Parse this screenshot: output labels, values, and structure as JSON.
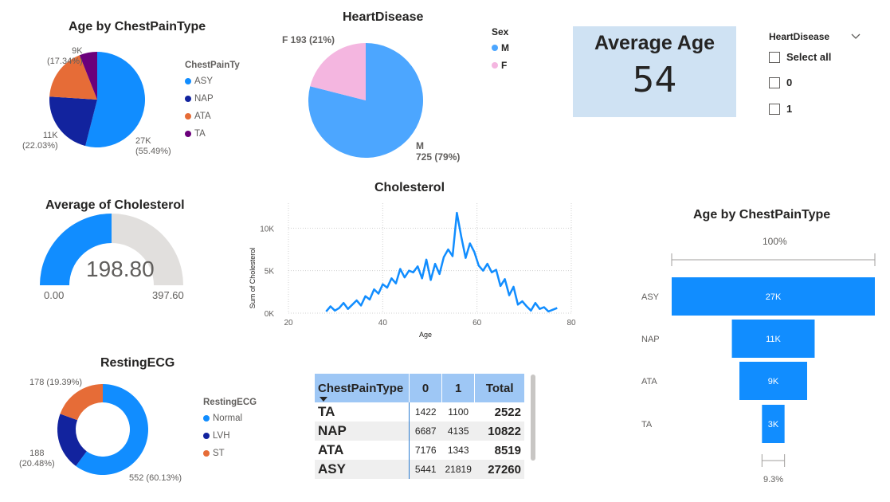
{
  "colors": {
    "asy": "#118dff",
    "nap": "#12239e",
    "ata": "#e66c37",
    "ta": "#6b007b",
    "male": "#4ca6ff",
    "female": "#f4b6e0",
    "gauge_fill": "#118dff",
    "gauge_bg": "#e1dfdd",
    "header": "#9ec7f5",
    "card_bg": "#cfe2f3"
  },
  "pie_age": {
    "title": "Age by ChestPainType",
    "legend_title": "ChestPainTy",
    "labels": {
      "asy": "27K\n(55.49%)",
      "nap": "11K\n(22.03%)",
      "ata": "9K\n(17.34%)"
    },
    "label_asy_1": "27K",
    "label_asy_2": "(55.49%)",
    "label_nap_1": "11K",
    "label_nap_2": "(22.03%)",
    "label_ata_1": "9K",
    "label_ata_2": "(17.34%)"
  },
  "pie_hd": {
    "title": "HeartDisease",
    "legend_title": "Sex",
    "label_f": "F 193 (21%)",
    "label_m_1": "M",
    "label_m_2": "725 (79%)",
    "legend": [
      "M",
      "F"
    ]
  },
  "card": {
    "title": "Average Age",
    "value": "54"
  },
  "slicer": {
    "title": "HeartDisease",
    "items": [
      "Select all",
      "0",
      "1"
    ]
  },
  "gauge": {
    "title": "Average of Cholesterol",
    "value": "198.80",
    "min": "0.00",
    "max": "397.60"
  },
  "line": {
    "title": "Cholesterol",
    "xlabel": "Age",
    "ylabel": "Sum of Cholesterol",
    "xticks": [
      "20",
      "40",
      "60",
      "80"
    ],
    "yticks": [
      "0K",
      "5K",
      "10K"
    ]
  },
  "donut": {
    "title": "RestingECG",
    "legend_title": "RestingECG",
    "label_st_1": "178 (19.39%)",
    "label_lvh_1": "188",
    "label_lvh_2": "(20.48%)",
    "label_normal": "552 (60.13%)"
  },
  "matrix": {
    "headers": [
      "ChestPainType",
      "0",
      "1",
      "Total"
    ],
    "rows": [
      {
        "type": "TA",
        "c0": "1422",
        "c1": "1100",
        "total": "2522"
      },
      {
        "type": "NAP",
        "c0": "6687",
        "c1": "4135",
        "total": "10822"
      },
      {
        "type": "ATA",
        "c0": "7176",
        "c1": "1343",
        "total": "8519"
      },
      {
        "type": "ASY",
        "c0": "5441",
        "c1": "21819",
        "total": "27260"
      }
    ]
  },
  "funnel": {
    "title": "Age by ChestPainType",
    "top_pct": "100%",
    "bottom_pct": "9.3%"
  },
  "chart_data": [
    {
      "type": "pie",
      "title": "Age by ChestPainType",
      "legend_title": "ChestPainTy",
      "categories": [
        "ASY",
        "NAP",
        "ATA",
        "TA"
      ],
      "values": [
        27000,
        11000,
        9000,
        3000
      ],
      "percentages": [
        55.49,
        22.03,
        17.34,
        5.14
      ]
    },
    {
      "type": "pie",
      "title": "HeartDisease",
      "legend_title": "Sex",
      "categories": [
        "M",
        "F"
      ],
      "values": [
        725,
        193
      ],
      "percentages": [
        79,
        21
      ]
    },
    {
      "type": "gauge",
      "title": "Average of Cholesterol",
      "value": 198.8,
      "min": 0.0,
      "max": 397.6
    },
    {
      "type": "line",
      "title": "Cholesterol",
      "xlabel": "Age",
      "ylabel": "Sum of Cholesterol",
      "xlim": [
        20,
        80
      ],
      "ylim": [
        0,
        12000
      ],
      "x": [
        28,
        29,
        30,
        31,
        32,
        33,
        34,
        35,
        36,
        37,
        38,
        39,
        40,
        41,
        42,
        43,
        44,
        45,
        46,
        47,
        48,
        49,
        50,
        51,
        52,
        53,
        54,
        55,
        56,
        57,
        58,
        59,
        60,
        61,
        62,
        63,
        64,
        65,
        66,
        67,
        68,
        69,
        70,
        71,
        72,
        73,
        74,
        75,
        76,
        77
      ],
      "values": [
        200,
        800,
        300,
        600,
        1200,
        500,
        1000,
        1500,
        900,
        2000,
        1600,
        2800,
        2300,
        3400,
        3000,
        4100,
        3500,
        5200,
        4200,
        5000,
        4800,
        5500,
        4100,
        6300,
        3900,
        5800,
        4600,
        6600,
        7500,
        6700,
        11800,
        9000,
        6500,
        8200,
        7200,
        5600,
        5000,
        5800,
        4800,
        5100,
        3200,
        4000,
        2100,
        3100,
        1000,
        1400,
        800,
        300,
        1200,
        500,
        700,
        200,
        400,
        600
      ]
    },
    {
      "type": "pie",
      "title": "RestingECG",
      "legend_title": "RestingECG",
      "categories": [
        "Normal",
        "LVH",
        "ST"
      ],
      "values": [
        552,
        188,
        178
      ],
      "percentages": [
        60.13,
        20.48,
        19.39
      ]
    },
    {
      "type": "table",
      "columns": [
        "ChestPainType",
        "0",
        "1",
        "Total"
      ],
      "rows": [
        [
          "TA",
          1422,
          1100,
          2522
        ],
        [
          "NAP",
          6687,
          4135,
          10822
        ],
        [
          "ATA",
          7176,
          1343,
          8519
        ],
        [
          "ASY",
          5441,
          21819,
          27260
        ]
      ]
    },
    {
      "type": "bar",
      "title": "Age by ChestPainType",
      "categories": [
        "ASY",
        "NAP",
        "ATA",
        "TA"
      ],
      "values": [
        27000,
        11000,
        9000,
        3000
      ],
      "labels": [
        "27K",
        "11K",
        "9K",
        "3K"
      ]
    }
  ]
}
